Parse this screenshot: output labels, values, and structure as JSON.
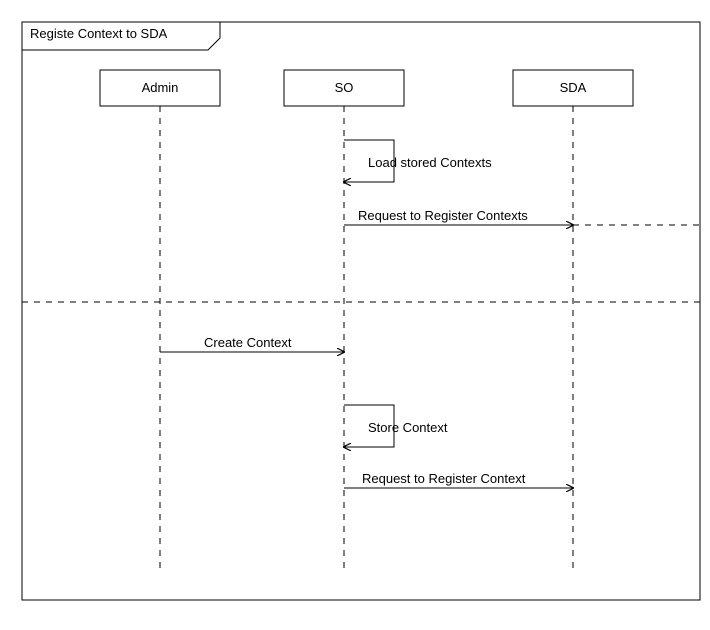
{
  "frame": {
    "title": "Registe Context to SDA"
  },
  "participants": {
    "admin": {
      "label": "Admin"
    },
    "so": {
      "label": "SO"
    },
    "sda": {
      "label": "SDA"
    }
  },
  "messages": {
    "m1": {
      "label": "Load stored Contexts"
    },
    "m2": {
      "label": "Request to Register Contexts"
    },
    "m3": {
      "label": "Create Context"
    },
    "m4": {
      "label": "Store Context"
    },
    "m5": {
      "label": "Request to Register Context"
    }
  }
}
